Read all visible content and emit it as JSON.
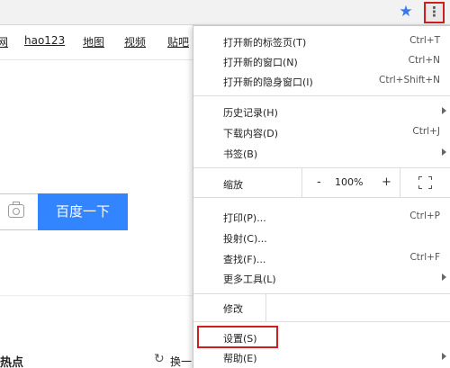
{
  "toolbar": {
    "star_icon": "star-icon",
    "menu_icon": "kebab-menu-icon",
    "menu_glyph": "⋮",
    "accent_color": "#3b78e7",
    "highlight_color": "#d01d1d"
  },
  "page": {
    "nav_links": [
      "网",
      "hao123",
      "地图",
      "视频",
      "贴吧"
    ],
    "search_button": "百度一下",
    "search_button_color": "#3385ff",
    "hot_label": "热点",
    "refresh_label": "换一"
  },
  "menu": {
    "group1": [
      {
        "label": "打开新的标签页(T)",
        "shortcut": "Ctrl+T"
      },
      {
        "label": "打开新的窗口(N)",
        "shortcut": "Ctrl+N"
      },
      {
        "label": "打开新的隐身窗口(I)",
        "shortcut": "Ctrl+Shift+N"
      }
    ],
    "group2": [
      {
        "label": "历史记录(H)",
        "shortcut": ""
      },
      {
        "label": "下载内容(D)",
        "shortcut": "Ctrl+J"
      },
      {
        "label": "书签(B)",
        "shortcut": ""
      }
    ],
    "zoom": {
      "label": "缩放",
      "minus": "-",
      "value": "100%",
      "plus": "+"
    },
    "group3": [
      {
        "label": "打印(P)...",
        "shortcut": "Ctrl+P"
      },
      {
        "label": "投射(C)...",
        "shortcut": ""
      },
      {
        "label": "查找(F)...",
        "shortcut": "Ctrl+F"
      },
      {
        "label": "更多工具(L)",
        "shortcut": ""
      }
    ],
    "edit": {
      "label": "修改"
    },
    "group4": [
      {
        "label": "设置(S)",
        "shortcut": ""
      },
      {
        "label": "帮助(E)",
        "shortcut": ""
      }
    ]
  }
}
